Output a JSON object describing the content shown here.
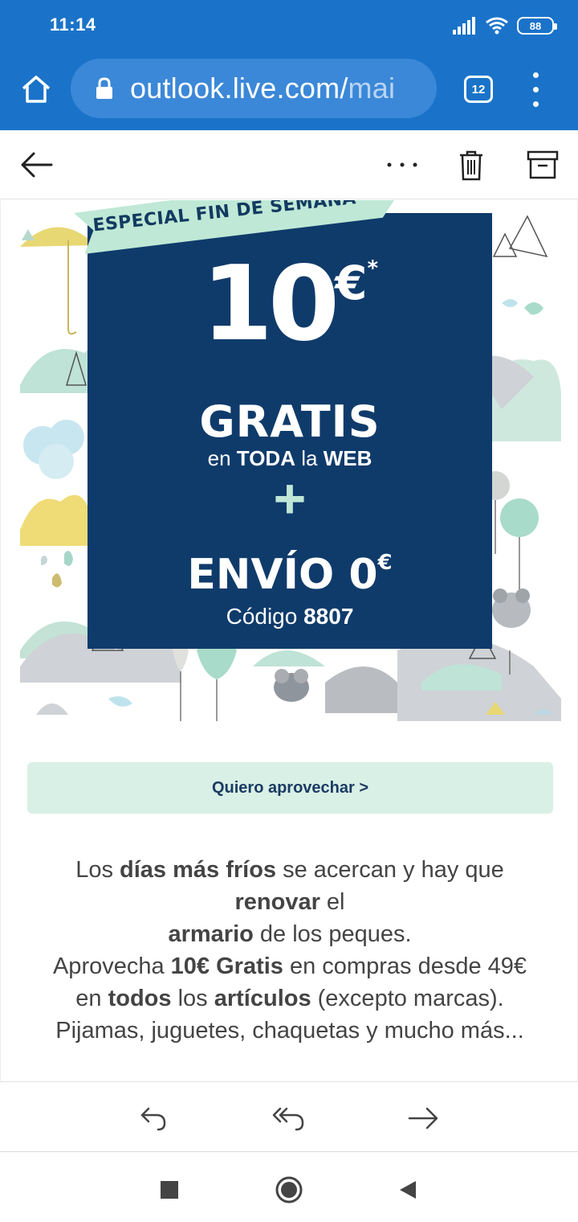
{
  "status": {
    "time": "11:14",
    "battery": "88"
  },
  "browser": {
    "url_main": "outlook.live.com/",
    "url_rest": "mai",
    "tab_count": "12"
  },
  "promo": {
    "ribbon": "ESPECIAL FIN DE SEMANA",
    "amount_number": "10",
    "amount_currency": "€",
    "amount_asterisk": "*",
    "headline": "GRATIS",
    "sub_pre": "en ",
    "sub_bold": "TODA",
    "sub_mid": " la ",
    "sub_bold2": "WEB",
    "plus": "+",
    "shipping": "ENVÍO 0",
    "shipping_currency": "€",
    "code_label": "Código ",
    "code_value": "8807"
  },
  "cta_label": "Quiero aprovechar >",
  "copy": {
    "l1_a": "Los ",
    "l1_b": "días más fríos",
    "l1_c": " se acercan y hay que",
    "l2_a": "renovar",
    "l2_b": " el",
    "l3_a": "armario",
    "l3_b": " de los peques.",
    "l4_a": "Aprovecha ",
    "l4_b": "10€ Gratis",
    "l4_c": " en compras desde 49€",
    "l5_a": "en ",
    "l5_b": "todos",
    "l5_c": " los ",
    "l5_d": "artículos",
    "l5_e": " (excepto marcas).",
    "l6": "Pijamas, juguetes, chaquetas y mucho más..."
  },
  "icons": {
    "home": "home-icon",
    "lock": "lock-icon",
    "tabs": "tabs-icon",
    "menu": "more-vert-icon",
    "back": "back-arrow-icon",
    "more": "more-horiz-icon",
    "delete": "trash-icon",
    "archive": "archive-icon",
    "reply": "reply-icon",
    "reply_all": "reply-all-icon",
    "forward": "forward-icon",
    "nav_recent": "recent-apps-icon",
    "nav_home": "nav-home-icon",
    "nav_back": "nav-back-icon"
  },
  "colors": {
    "browser_blue": "#1a73c9",
    "promo_navy": "#0f3b6b",
    "cta_mint": "#d9f0e6",
    "ribbon_mint": "#bfe8d6"
  }
}
